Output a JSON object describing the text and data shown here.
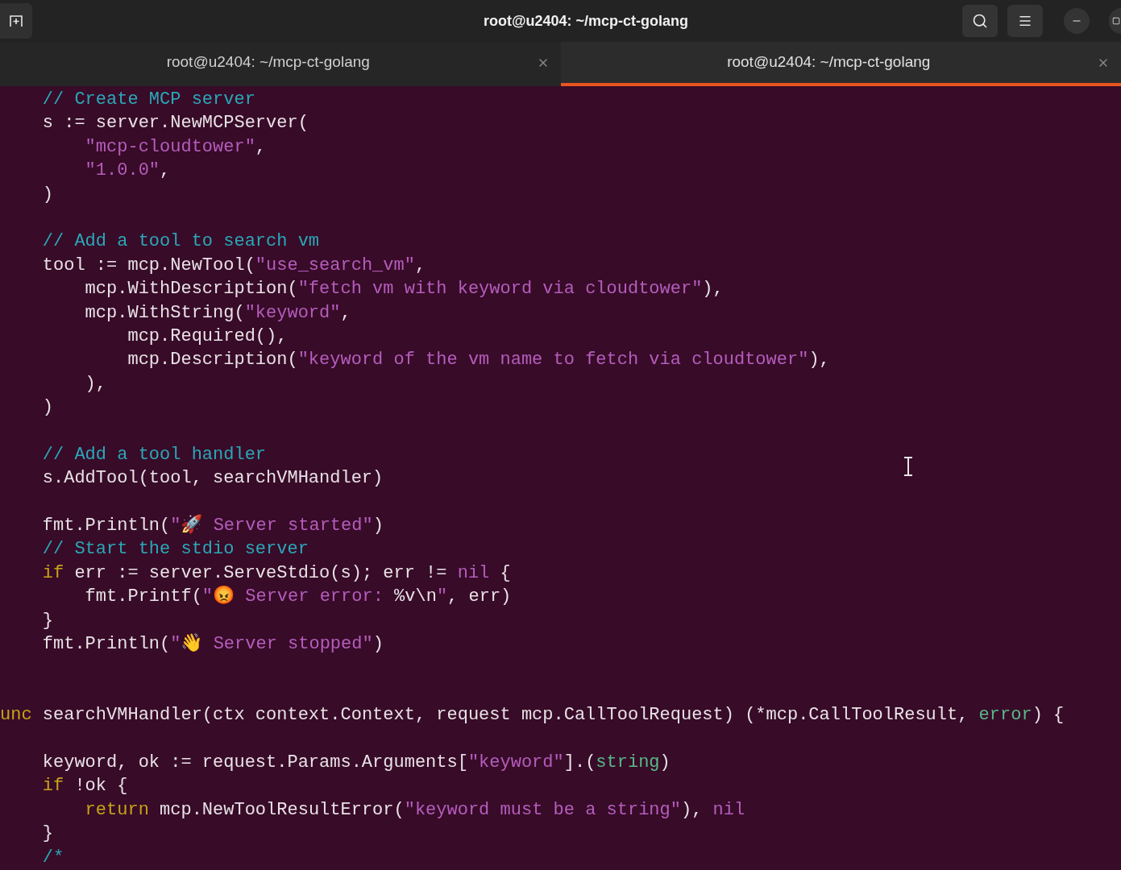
{
  "window": {
    "title": "root@u2404: ~/mcp-ct-golang"
  },
  "tabs": [
    {
      "label": "root@u2404: ~/mcp-ct-golang",
      "selected": false
    },
    {
      "label": "root@u2404: ~/mcp-ct-golang",
      "selected": true
    }
  ],
  "lines": [
    {
      "kind": "code",
      "tokens": [
        {
          "kind": "comment",
          "text": "    // Create MCP server"
        }
      ]
    },
    {
      "kind": "code",
      "tokens": [
        {
          "kind": "plain",
          "text": "    s := server.NewMCPServer("
        }
      ]
    },
    {
      "kind": "code",
      "tokens": [
        {
          "kind": "string",
          "text": "        \"mcp-cloudtower\""
        },
        {
          "kind": "plain",
          "text": ","
        }
      ]
    },
    {
      "kind": "code",
      "tokens": [
        {
          "kind": "string",
          "text": "        \"1.0.0\""
        },
        {
          "kind": "plain",
          "text": ","
        }
      ]
    },
    {
      "kind": "code",
      "tokens": [
        {
          "kind": "plain",
          "text": "    )"
        }
      ]
    },
    {
      "kind": "blank"
    },
    {
      "kind": "code",
      "tokens": [
        {
          "kind": "comment",
          "text": "    // Add a tool to search vm"
        }
      ]
    },
    {
      "kind": "code",
      "tokens": [
        {
          "kind": "plain",
          "text": "    tool := mcp.NewTool("
        },
        {
          "kind": "string",
          "text": "\"use_search_vm\""
        },
        {
          "kind": "plain",
          "text": ","
        }
      ]
    },
    {
      "kind": "code",
      "tokens": [
        {
          "kind": "plain",
          "text": "        mcp.WithDescription("
        },
        {
          "kind": "string",
          "text": "\"fetch vm with keyword via cloudtower\""
        },
        {
          "kind": "plain",
          "text": "),"
        }
      ]
    },
    {
      "kind": "code",
      "tokens": [
        {
          "kind": "plain",
          "text": "        mcp.WithString("
        },
        {
          "kind": "string",
          "text": "\"keyword\""
        },
        {
          "kind": "plain",
          "text": ","
        }
      ]
    },
    {
      "kind": "code",
      "tokens": [
        {
          "kind": "plain",
          "text": "            mcp.Required(),"
        }
      ]
    },
    {
      "kind": "code",
      "tokens": [
        {
          "kind": "plain",
          "text": "            mcp.Description("
        },
        {
          "kind": "string",
          "text": "\"keyword of the vm name to fetch via cloudtower\""
        },
        {
          "kind": "plain",
          "text": "),"
        }
      ]
    },
    {
      "kind": "code",
      "tokens": [
        {
          "kind": "plain",
          "text": "        ),"
        }
      ]
    },
    {
      "kind": "code",
      "tokens": [
        {
          "kind": "plain",
          "text": "    )"
        }
      ]
    },
    {
      "kind": "blank"
    },
    {
      "kind": "code",
      "tokens": [
        {
          "kind": "comment",
          "text": "    // Add a tool handler"
        }
      ]
    },
    {
      "kind": "code",
      "tokens": [
        {
          "kind": "plain",
          "text": "    s.AddTool(tool, searchVMHandler)"
        }
      ]
    },
    {
      "kind": "blank"
    },
    {
      "kind": "code",
      "tokens": [
        {
          "kind": "plain",
          "text": "    fmt.Println("
        },
        {
          "kind": "string",
          "text": "\"🚀 Server started\""
        },
        {
          "kind": "plain",
          "text": ")"
        }
      ]
    },
    {
      "kind": "code",
      "tokens": [
        {
          "kind": "comment",
          "text": "    // Start the stdio server"
        }
      ]
    },
    {
      "kind": "code",
      "tokens": [
        {
          "kind": "keyword",
          "text": "    if"
        },
        {
          "kind": "plain",
          "text": " err := server.ServeStdio(s); err != "
        },
        {
          "kind": "nil",
          "text": "nil"
        },
        {
          "kind": "plain",
          "text": " {"
        }
      ]
    },
    {
      "kind": "code",
      "tokens": [
        {
          "kind": "plain",
          "text": "        fmt.Printf("
        },
        {
          "kind": "string",
          "text": "\"😡 Server error: "
        },
        {
          "kind": "plain",
          "text": "%v\\n"
        },
        {
          "kind": "string",
          "text": "\""
        },
        {
          "kind": "plain",
          "text": ", err)"
        }
      ]
    },
    {
      "kind": "code",
      "tokens": [
        {
          "kind": "plain",
          "text": "    }"
        }
      ]
    },
    {
      "kind": "code",
      "tokens": [
        {
          "kind": "plain",
          "text": "    fmt.Println("
        },
        {
          "kind": "string",
          "text": "\"👋 Server stopped\""
        },
        {
          "kind": "plain",
          "text": ")"
        }
      ]
    },
    {
      "kind": "blank"
    },
    {
      "kind": "blank"
    },
    {
      "kind": "code",
      "tokens": [
        {
          "kind": "keyword",
          "text": "unc"
        },
        {
          "kind": "plain",
          "text": " searchVMHandler(ctx context.Context, request mcp.CallToolRequest) (*mcp.CallToolResult, "
        },
        {
          "kind": "type",
          "text": "error"
        },
        {
          "kind": "plain",
          "text": ") {"
        }
      ]
    },
    {
      "kind": "blank"
    },
    {
      "kind": "code",
      "tokens": [
        {
          "kind": "plain",
          "text": "    keyword, ok := request.Params.Arguments["
        },
        {
          "kind": "string",
          "text": "\"keyword\""
        },
        {
          "kind": "plain",
          "text": "].("
        },
        {
          "kind": "type",
          "text": "string"
        },
        {
          "kind": "plain",
          "text": ")"
        }
      ]
    },
    {
      "kind": "code",
      "tokens": [
        {
          "kind": "keyword",
          "text": "    if"
        },
        {
          "kind": "plain",
          "text": " !ok {"
        }
      ]
    },
    {
      "kind": "code",
      "tokens": [
        {
          "kind": "keyword",
          "text": "        return"
        },
        {
          "kind": "plain",
          "text": " mcp.NewToolResultError("
        },
        {
          "kind": "string",
          "text": "\"keyword must be a string\""
        },
        {
          "kind": "plain",
          "text": "), "
        },
        {
          "kind": "nil",
          "text": "nil"
        }
      ]
    },
    {
      "kind": "code",
      "tokens": [
        {
          "kind": "plain",
          "text": "    }"
        }
      ]
    },
    {
      "kind": "code",
      "tokens": [
        {
          "kind": "comment",
          "text": "    /*"
        }
      ]
    }
  ]
}
